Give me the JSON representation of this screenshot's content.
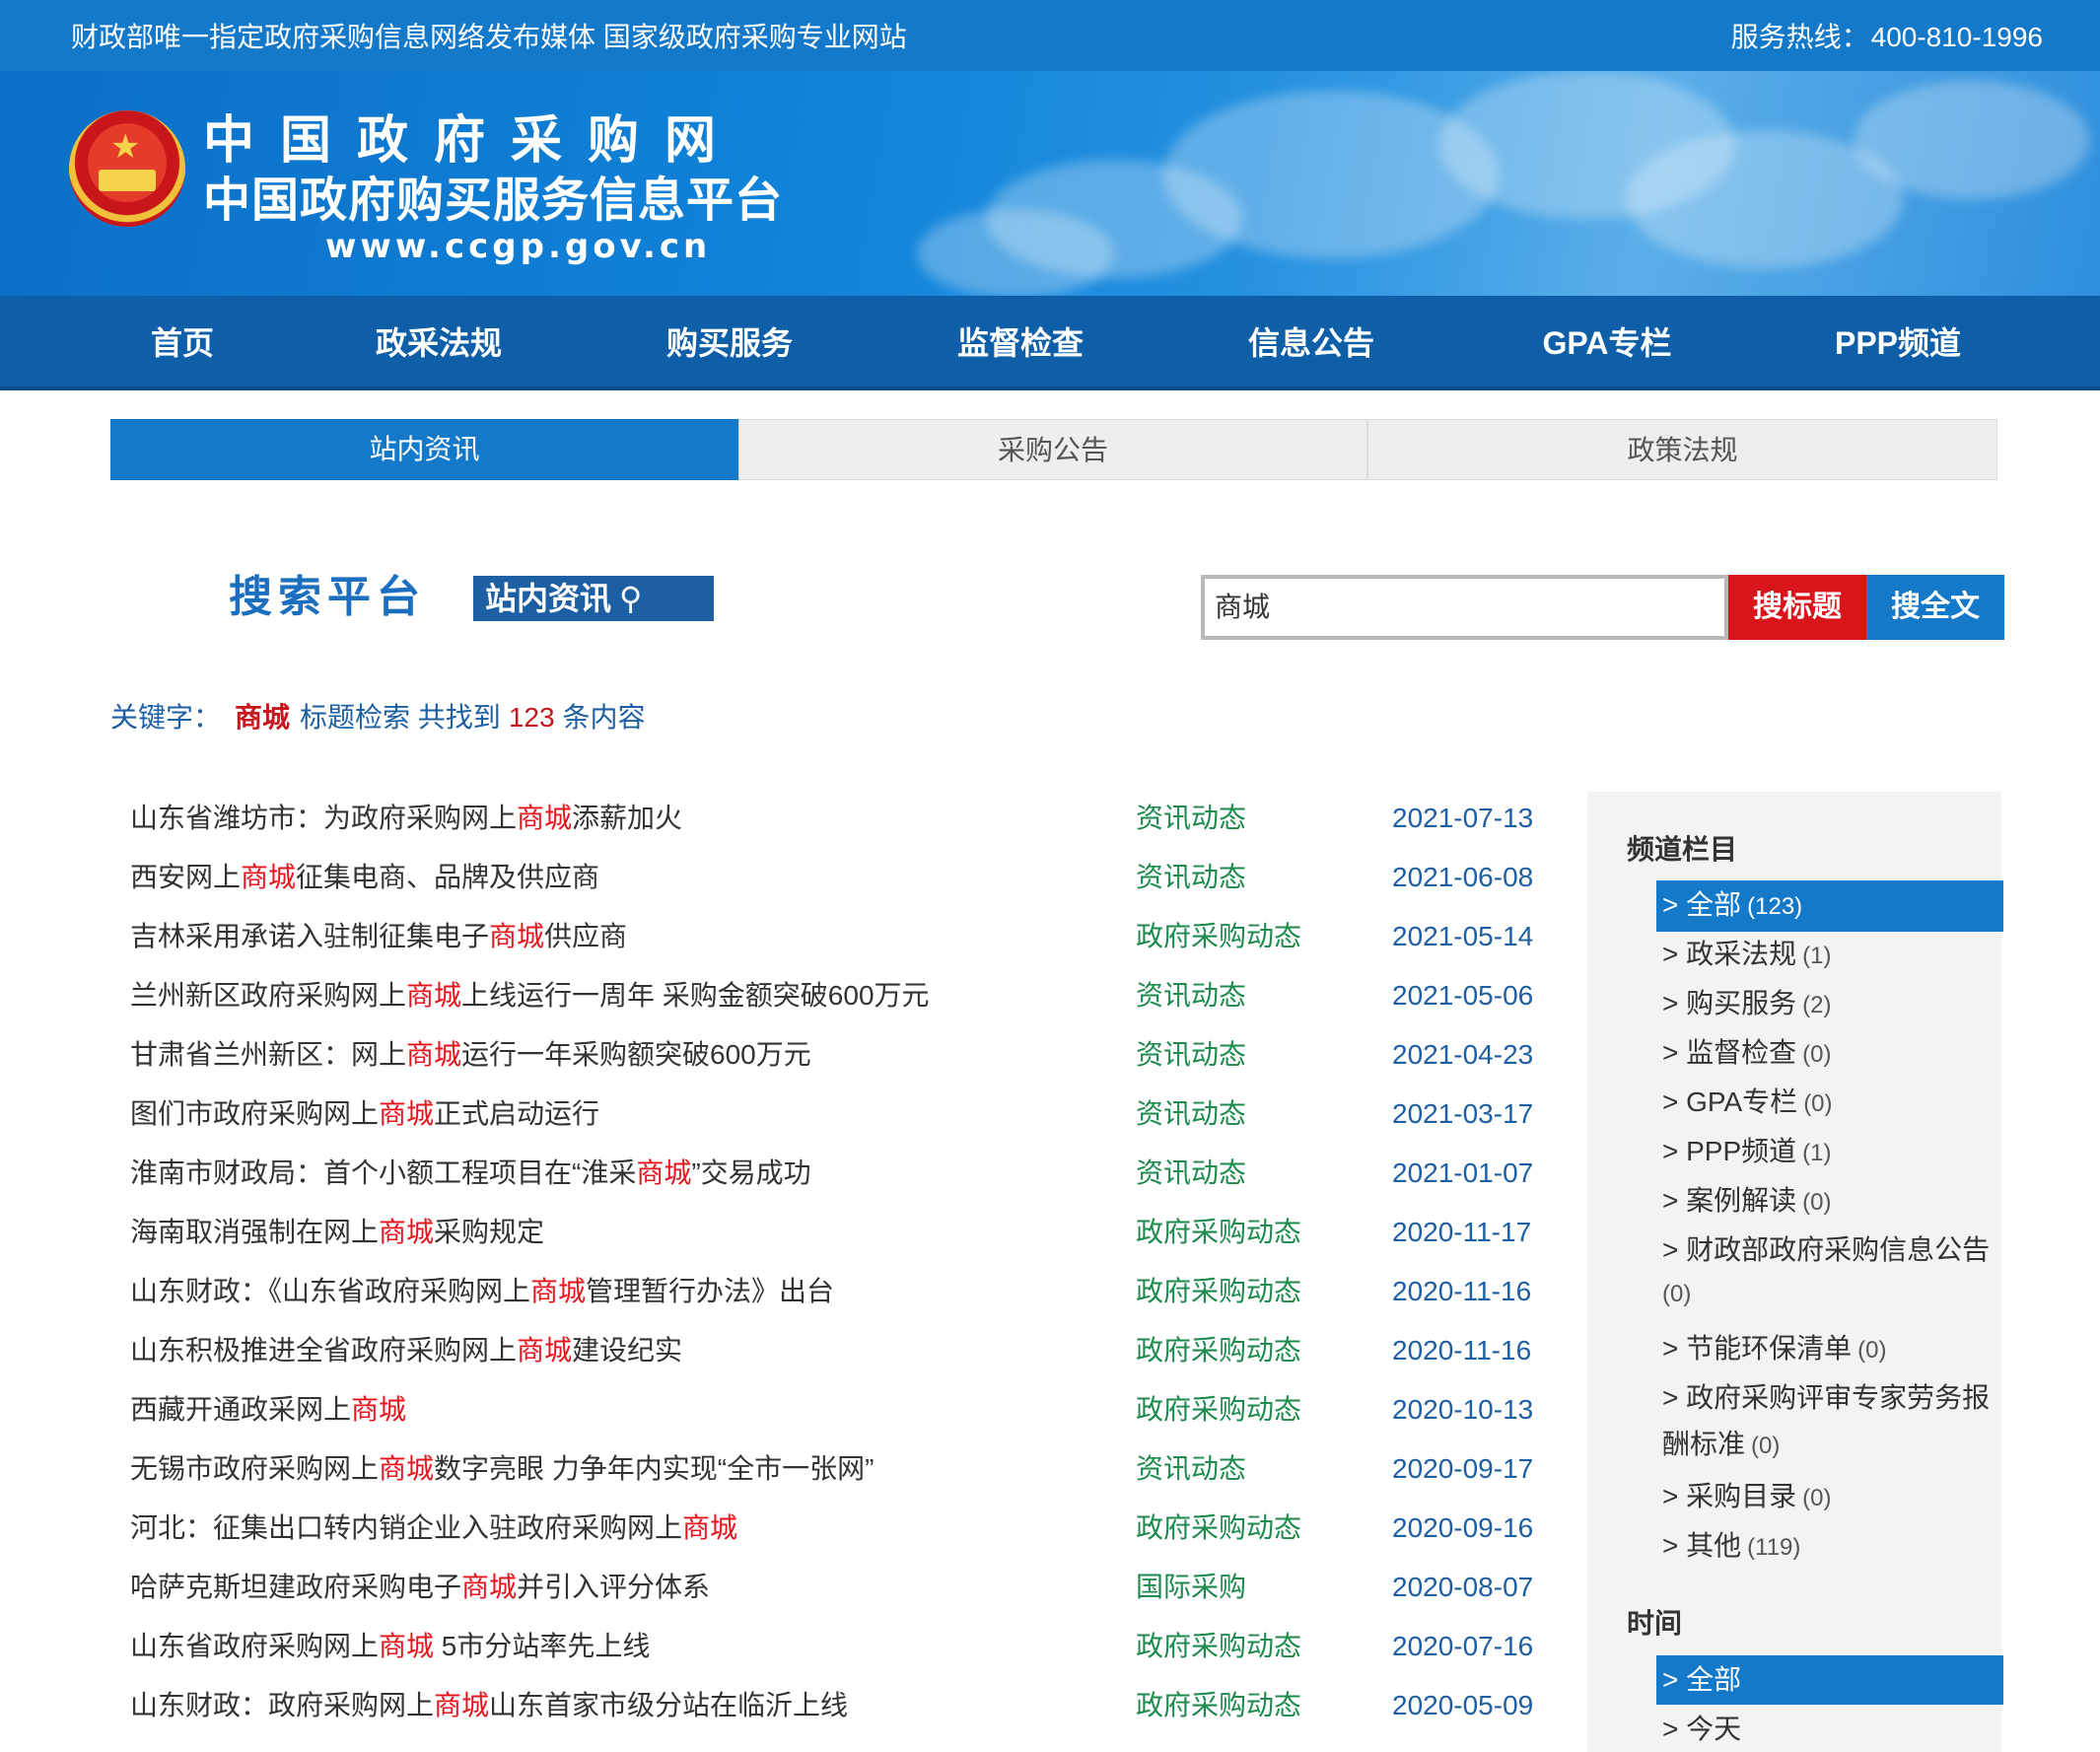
{
  "topbar": {
    "slogan": "财政部唯一指定政府采购信息网络发布媒体 国家级政府采购专业网站",
    "hotline_label": "服务热线：",
    "hotline_number": "400-810-1996"
  },
  "banner": {
    "title": "中国政府采购网",
    "subtitle": "中国政府购买服务信息平台",
    "url": "www.ccgp.gov.cn",
    "emblem_icon": "national-emblem-icon"
  },
  "nav": {
    "items": [
      "首页",
      "政采法规",
      "购买服务",
      "监督检查",
      "信息公告",
      "GPA专栏",
      "PPP频道"
    ]
  },
  "tabs": [
    "站内资讯",
    "采购公告",
    "政策法规"
  ],
  "search": {
    "logo_text": "搜索平台",
    "logo_tag": "站内资讯",
    "search_icon": "search-icon",
    "query": "商城",
    "btn_title": "搜标题",
    "btn_full": "搜全文"
  },
  "summary": {
    "label": "关键字：",
    "keyword": "商城",
    "mode": "标题检索 共找到",
    "count": "123",
    "suffix": "条内容"
  },
  "results": [
    {
      "pre": "山东省潍坊市：为政府采购网上",
      "hl": "商城",
      "post": "添薪加火",
      "category": "资讯动态",
      "date": "2021-07-13"
    },
    {
      "pre": "西安网上",
      "hl": "商城",
      "post": "征集电商、品牌及供应商",
      "category": "资讯动态",
      "date": "2021-06-08"
    },
    {
      "pre": "吉林采用承诺入驻制征集电子",
      "hl": "商城",
      "post": "供应商",
      "category": "政府采购动态",
      "date": "2021-05-14"
    },
    {
      "pre": "兰州新区政府采购网上",
      "hl": "商城",
      "post": "上线运行一周年 采购金额突破600万元",
      "category": "资讯动态",
      "date": "2021-05-06"
    },
    {
      "pre": "甘肃省兰州新区：网上",
      "hl": "商城",
      "post": "运行一年采购额突破600万元",
      "category": "资讯动态",
      "date": "2021-04-23"
    },
    {
      "pre": "图们市政府采购网上",
      "hl": "商城",
      "post": "正式启动运行",
      "category": "资讯动态",
      "date": "2021-03-17"
    },
    {
      "pre": "淮南市财政局：首个小额工程项目在“淮采",
      "hl": "商城",
      "post": "”交易成功",
      "category": "资讯动态",
      "date": "2021-01-07"
    },
    {
      "pre": "海南取消强制在网上",
      "hl": "商城",
      "post": "采购规定",
      "category": "政府采购动态",
      "date": "2020-11-17"
    },
    {
      "pre": "山东财政：《山东省政府采购网上",
      "hl": "商城",
      "post": "管理暂行办法》出台",
      "category": "政府采购动态",
      "date": "2020-11-16"
    },
    {
      "pre": "山东积极推进全省政府采购网上",
      "hl": "商城",
      "post": "建设纪实",
      "category": "政府采购动态",
      "date": "2020-11-16"
    },
    {
      "pre": "西藏开通政采网上",
      "hl": "商城",
      "post": "",
      "category": "政府采购动态",
      "date": "2020-10-13"
    },
    {
      "pre": "无锡市政府采购网上",
      "hl": "商城",
      "post": "数字亮眼 力争年内实现“全市一张网”",
      "category": "资讯动态",
      "date": "2020-09-17"
    },
    {
      "pre": "河北：征集出口转内销企业入驻政府采购网上",
      "hl": "商城",
      "post": "",
      "category": "政府采购动态",
      "date": "2020-09-16"
    },
    {
      "pre": "哈萨克斯坦建政府采购电子",
      "hl": "商城",
      "post": "并引入评分体系",
      "category": "国际采购",
      "date": "2020-08-07"
    },
    {
      "pre": "山东省政府采购网上",
      "hl": "商城",
      "post": " 5市分站率先上线",
      "category": "政府采购动态",
      "date": "2020-07-16"
    },
    {
      "pre": "山东财政：政府采购网上",
      "hl": "商城",
      "post": "山东首家市级分站在临沂上线",
      "category": "政府采购动态",
      "date": "2020-05-09"
    }
  ],
  "sidebar": {
    "channel_title": "频道栏目",
    "channels": [
      {
        "label": "> 全部",
        "count": "(123)"
      },
      {
        "label": "> 政采法规",
        "count": "(1)"
      },
      {
        "label": "> 购买服务",
        "count": "(2)"
      },
      {
        "label": "> 监督检查",
        "count": "(0)"
      },
      {
        "label": "> GPA专栏",
        "count": "(0)"
      },
      {
        "label": "> PPP频道",
        "count": "(1)"
      },
      {
        "label": "> 案例解读",
        "count": "(0)"
      },
      {
        "label": "> 财政部政府采购信息公告",
        "count": "(0)"
      },
      {
        "label": "> 节能环保清单",
        "count": "(0)"
      },
      {
        "label": "> 政府采购评审专家劳务报",
        "cont": "酬标准",
        "count": "(0)"
      },
      {
        "label": "> 采购目录",
        "count": "(0)"
      },
      {
        "label": "> 其他",
        "count": "(119)"
      }
    ],
    "time_title": "时间",
    "times": [
      "> 全部",
      "> 今天"
    ]
  }
}
